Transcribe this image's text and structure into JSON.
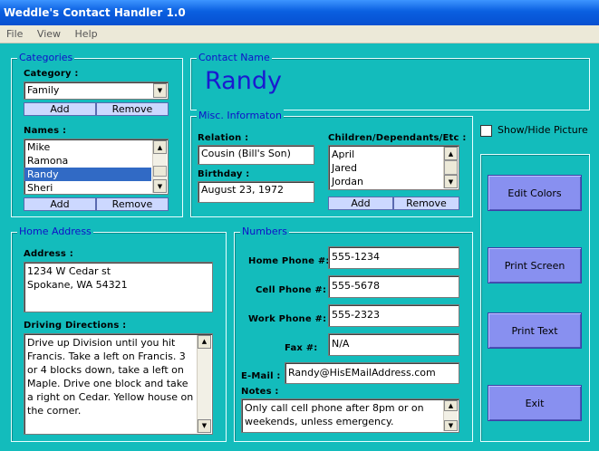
{
  "window": {
    "title": "Weddle's Contact Handler 1.0"
  },
  "menu": {
    "items": [
      "File",
      "View",
      "Help"
    ]
  },
  "categories": {
    "group_title": "Categories",
    "category_label": "Category :",
    "category_value": "Family",
    "add_label": "Add",
    "remove_label": "Remove",
    "names_label": "Names :",
    "names": [
      "Mike",
      "Ramona",
      "Randy",
      "Sheri"
    ],
    "selected_name": "Randy",
    "names_add_label": "Add",
    "names_remove_label": "Remove"
  },
  "contact_name": {
    "group_title": "Contact Name",
    "value": "Randy",
    "color": "#1a1ad0"
  },
  "misc": {
    "group_title": "Misc. Informaton",
    "relation_label": "Relation :",
    "relation_value": "Cousin (Bill's Son)",
    "birthday_label": "Birthday :",
    "birthday_value": "August 23, 1972",
    "children_label": "Children/Dependants/Etc :",
    "children": [
      "April",
      "Jared",
      "Jordan"
    ],
    "add_label": "Add",
    "remove_label": "Remove"
  },
  "picture": {
    "toggle_label": "Show/Hide Picture",
    "checked": false
  },
  "home_address": {
    "group_title": "Home Address",
    "address_label": "Address :",
    "address_lines": [
      "1234 W Cedar st",
      "Spokane, WA 54321"
    ],
    "directions_label": "Driving Directions :",
    "directions": "Drive up Division until you hit Francis. Take a left on Francis. 3 or 4 blocks down, take a left on Maple. Drive one block and take a right on Cedar. Yellow house on the corner."
  },
  "numbers": {
    "group_title": "Numbers",
    "home_label": "Home Phone #:",
    "home_value": "555-1234",
    "cell_label": "Cell Phone #:",
    "cell_value": "555-5678",
    "work_label": "Work Phone #:",
    "work_value": "555-2323",
    "fax_label": "Fax #:",
    "fax_value": "N/A",
    "email_label": "E-Mail :",
    "email_value": "Randy@HisEMailAddress.com",
    "notes_label": "Notes :",
    "notes_value": "Only call cell phone after 8pm or on weekends, unless emergency."
  },
  "actions": {
    "edit_colors": "Edit Colors",
    "print_screen": "Print Screen",
    "print_text": "Print Text",
    "exit": "Exit"
  },
  "colors": {
    "client_bg": "#13bcbc",
    "group_title": "#1010c8",
    "button_face": "#8890f0",
    "small_button_face": "#ccd8ff",
    "selection": "#316ac5"
  }
}
